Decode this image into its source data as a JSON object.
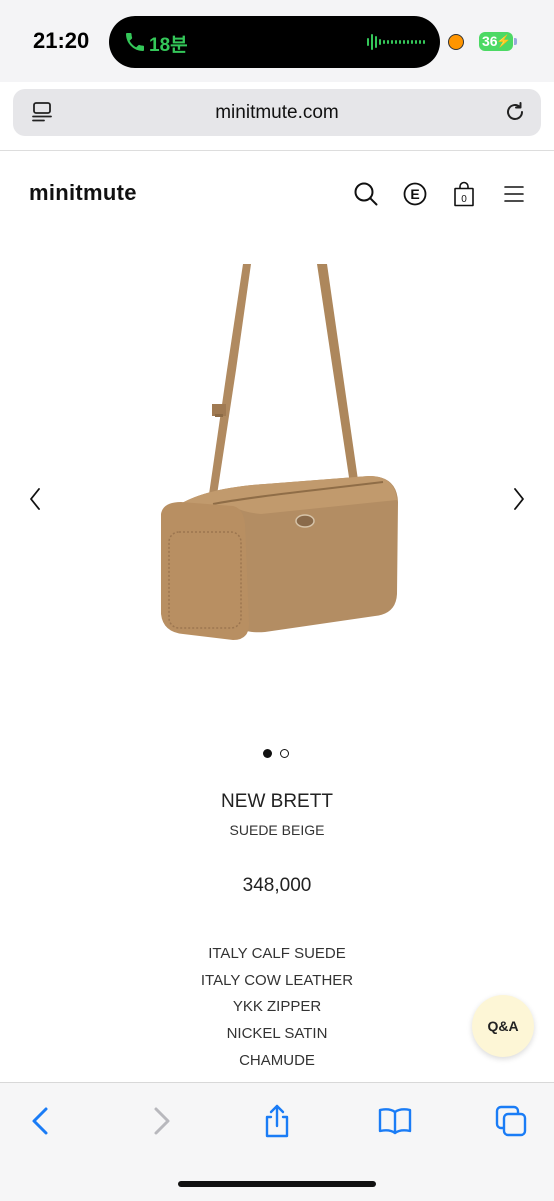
{
  "status_bar": {
    "time": "21:20",
    "call_duration": "18분",
    "battery": "36",
    "call_icon": "phone-icon",
    "battery_color": "#4cd964",
    "call_color": "#34c759"
  },
  "browser": {
    "url": "minitmute.com",
    "reader_icon": "reader-icon",
    "reload_icon": "reload-icon"
  },
  "site_header": {
    "logo": "minitmute",
    "e_icon_letter": "E",
    "cart_count": "0",
    "icons": [
      "search-icon",
      "e-icon",
      "cart-icon",
      "menu-icon"
    ]
  },
  "product": {
    "name": "NEW BRETT",
    "color": "SUEDE BEIGE",
    "price": "348,000",
    "image_count": 2,
    "current_image": 1,
    "materials": [
      "ITALY CALF SUEDE",
      "ITALY COW LEATHER",
      "YKK ZIPPER",
      "NICKEL SATIN",
      "CHAMUDE"
    ],
    "bag_color": "#b38d63"
  },
  "qa_button": {
    "label": "Q&A",
    "background": "#fdf6d6"
  },
  "toolbar": {
    "accent": "#1a7cf6",
    "items": [
      "back-icon",
      "forward-icon",
      "share-icon",
      "bookmarks-icon",
      "tabs-icon"
    ]
  }
}
